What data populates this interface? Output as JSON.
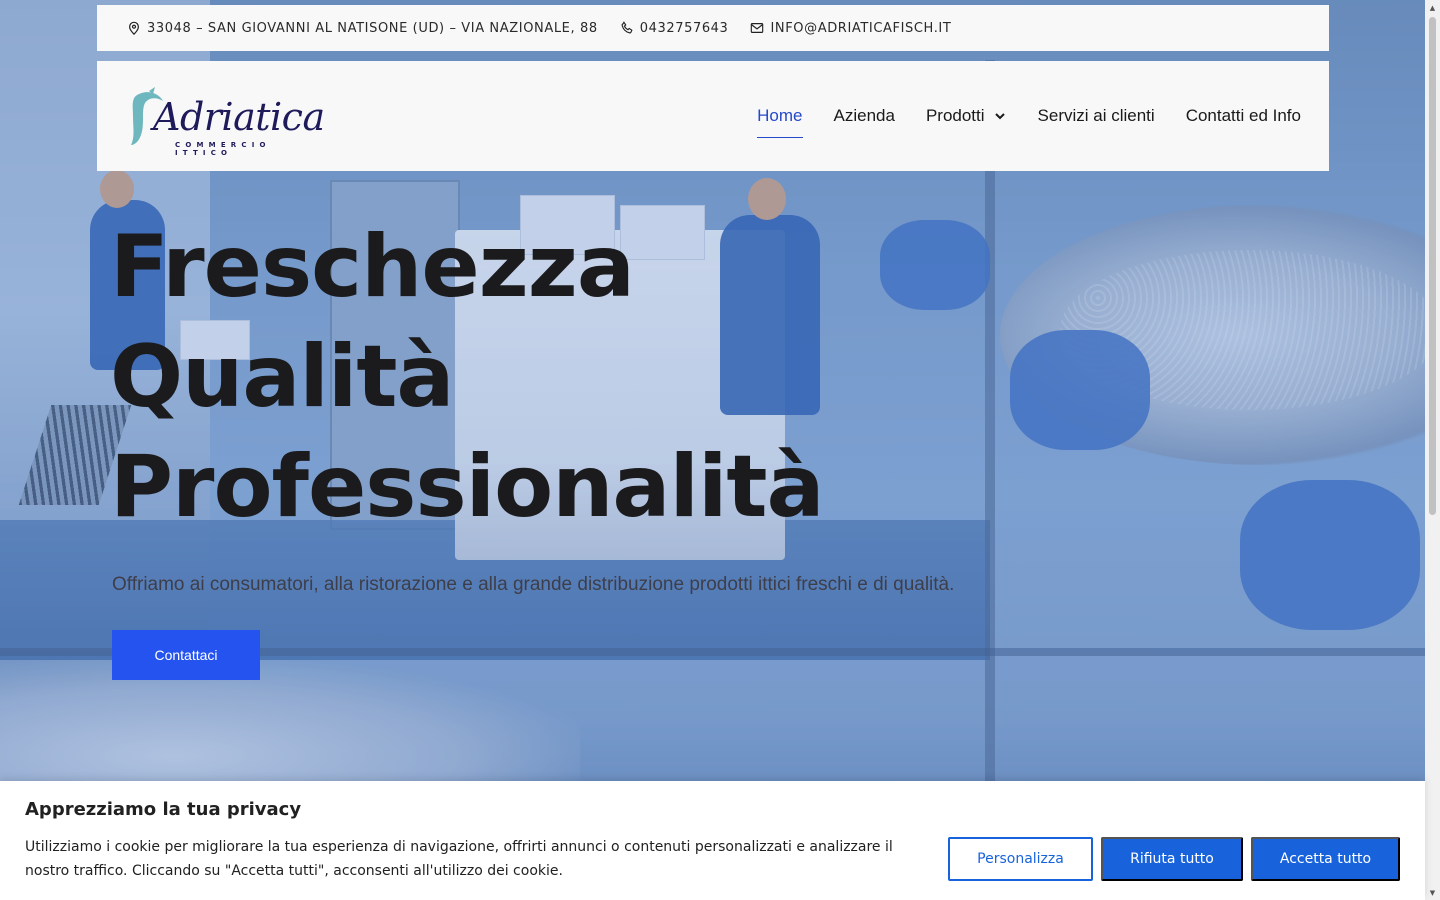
{
  "topbar": {
    "address": "33048 – SAN GIOVANNI AL NATISONE (UD) – VIA NAZIONALE, 88",
    "phone": "0432757643",
    "email": "INFO@ADRIATICAFISCH.IT"
  },
  "logo": {
    "name": "Adriatica",
    "tagline": "COMMERCIO ITTICO"
  },
  "nav": {
    "items": [
      {
        "label": "Home",
        "active": true
      },
      {
        "label": "Azienda"
      },
      {
        "label": "Prodotti",
        "has_dropdown": true
      },
      {
        "label": "Servizi ai clienti"
      },
      {
        "label": "Contatti ed Info"
      }
    ]
  },
  "hero": {
    "title_lines": [
      "Freschezza",
      "Qualità",
      "Professionalità"
    ],
    "subtitle": "Offriamo ai consumatori, alla ristorazione e alla grande distribuzione prodotti ittici freschi e di qualità.",
    "cta_label": "Contattaci"
  },
  "cookie_banner": {
    "title": "Apprezziamo la tua privacy",
    "description": "Utilizziamo i cookie per migliorare la tua esperienza di navigazione, offrirti annunci o contenuti personalizzati e analizzare il nostro traffico. Cliccando su \"Accetta tutti\", acconsenti all'utilizzo dei cookie.",
    "customize_label": "Personalizza",
    "reject_label": "Rifiuta tutto",
    "accept_label": "Accetta tutto"
  },
  "colors": {
    "accent": "#2553f0",
    "nav_active": "#2449c9",
    "cookie_button": "#1863dc",
    "logo": "#1f1b5a"
  },
  "icons": {
    "address": "map-pin-icon",
    "phone": "phone-icon",
    "email": "mail-icon",
    "dropdown": "chevron-down-icon"
  }
}
